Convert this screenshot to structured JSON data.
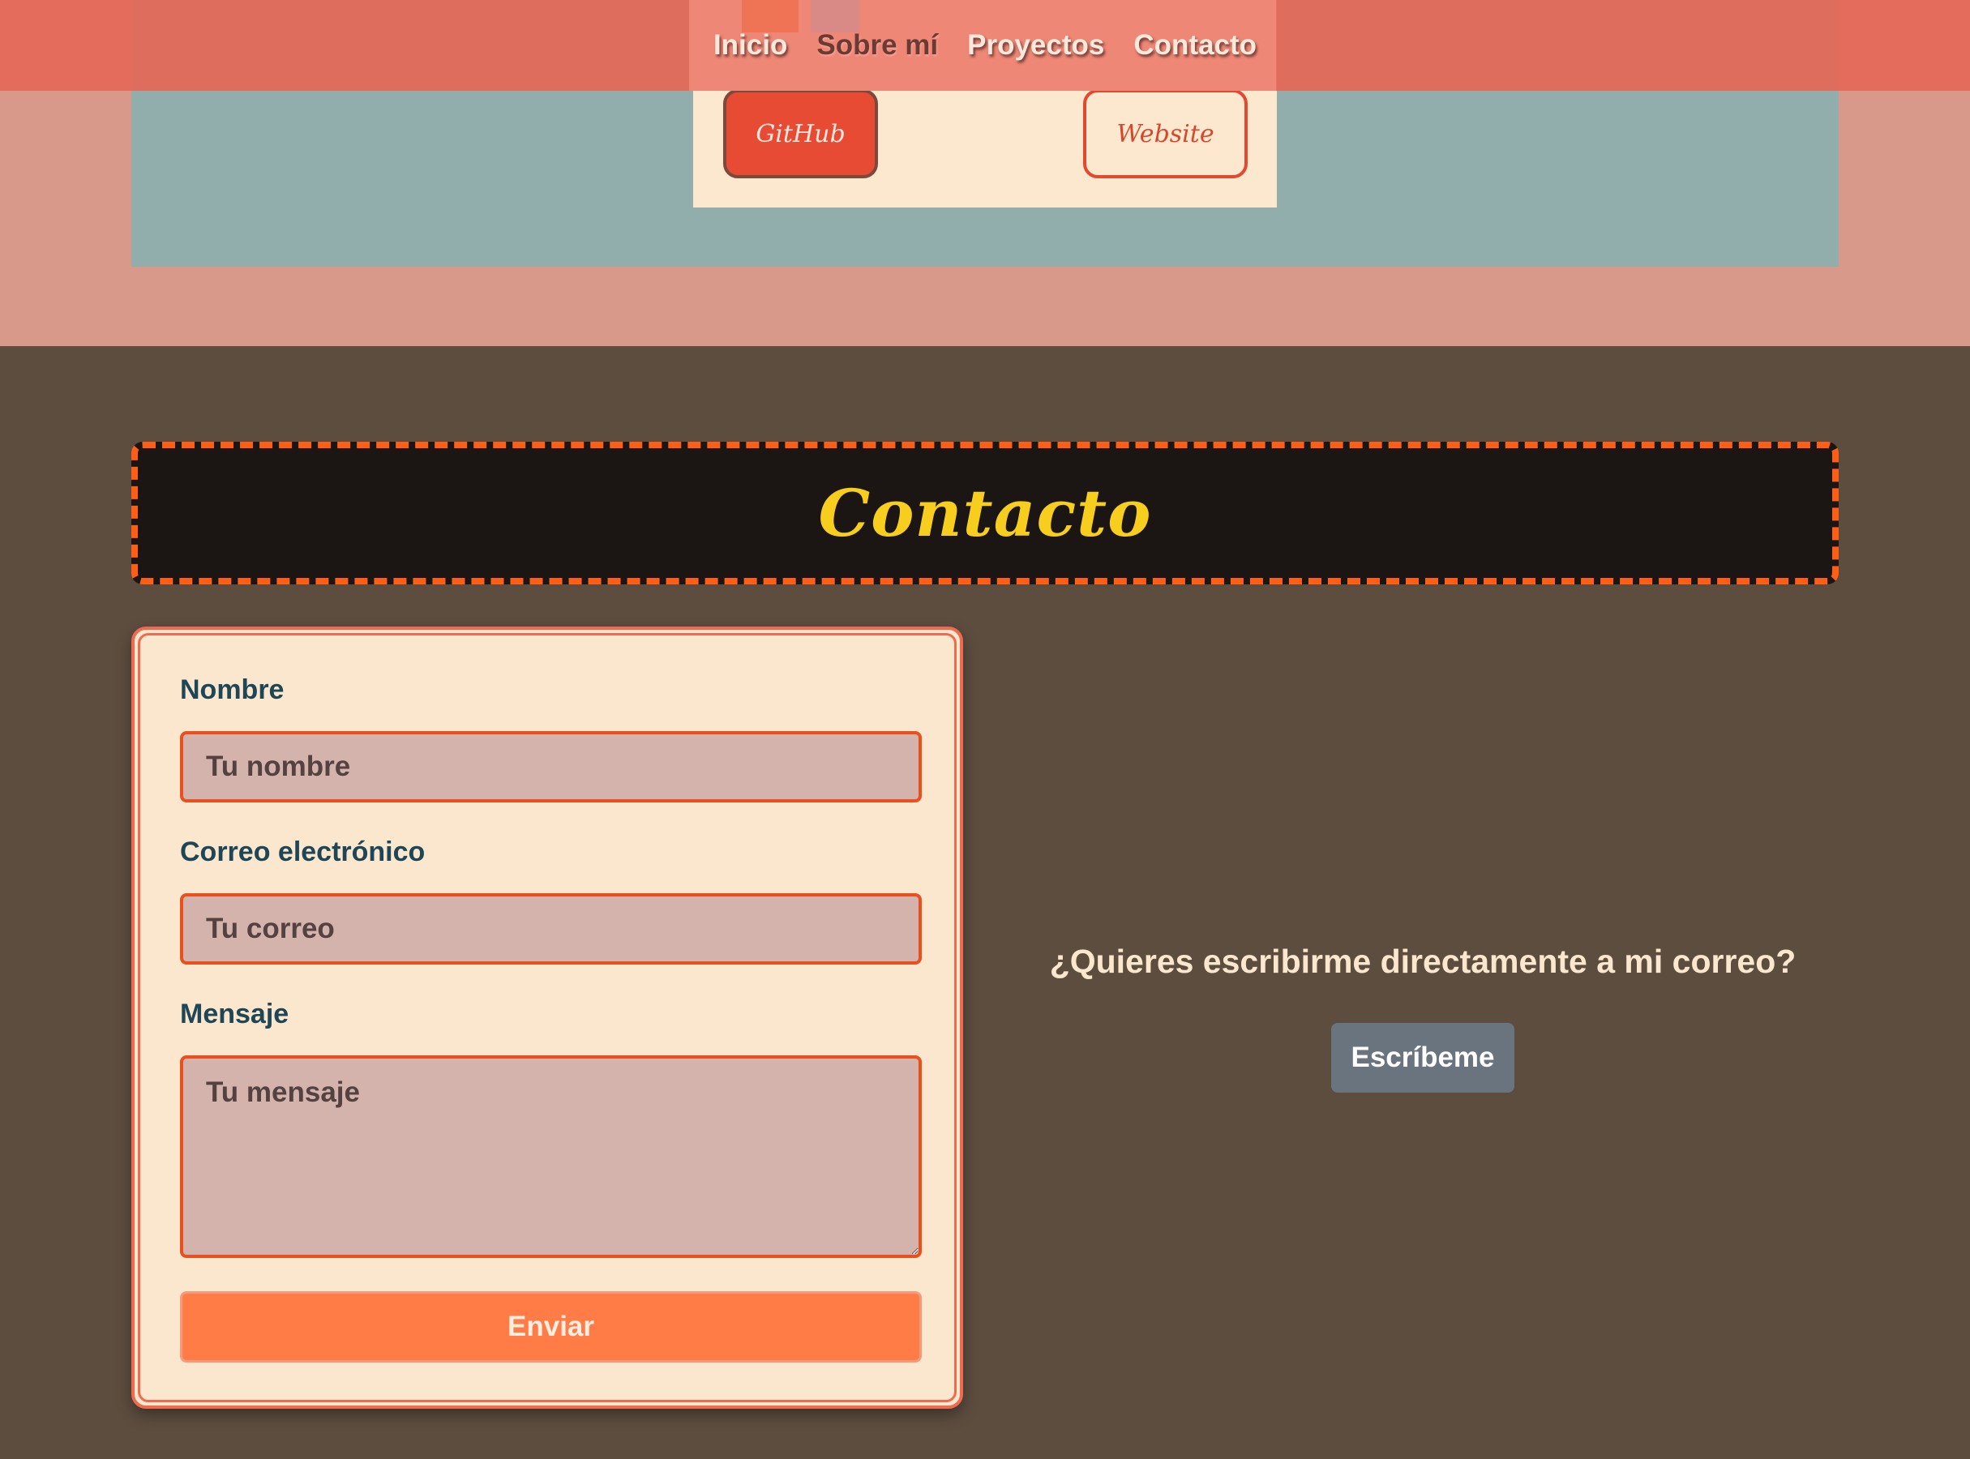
{
  "nav": {
    "links": [
      {
        "label": "Inicio"
      },
      {
        "label": "Sobre mí"
      },
      {
        "label": "Proyectos"
      },
      {
        "label": "Contacto"
      }
    ]
  },
  "project_card": {
    "github_label": "GitHub",
    "website_label": "Website"
  },
  "contact": {
    "title": "Contacto",
    "form": {
      "name_label": "Nombre",
      "name_placeholder": "Tu nombre",
      "email_label": "Correo electrónico",
      "email_placeholder": "Tu correo",
      "message_label": "Mensaje",
      "message_placeholder": "Tu mensaje",
      "submit_label": "Enviar"
    },
    "direct": {
      "question": "¿Quieres escribirme directamente a mi correo?",
      "button_label": "Escríbeme"
    }
  },
  "colors": {
    "navbar": "#e46858",
    "projects_background": "#d8988a",
    "projects_band": "#92aeac",
    "card_background": "#fce8ce",
    "page_background": "#5d4d3f",
    "banner_background": "#1b1613",
    "banner_border": "#ff5e14",
    "title_yellow": "#f7ce1d",
    "label_color": "#1f4656",
    "input_background": "#d4b3ad",
    "input_border": "#ea4f1f",
    "submit_button": "#ff7c46",
    "mail_button": "#6a747f"
  }
}
